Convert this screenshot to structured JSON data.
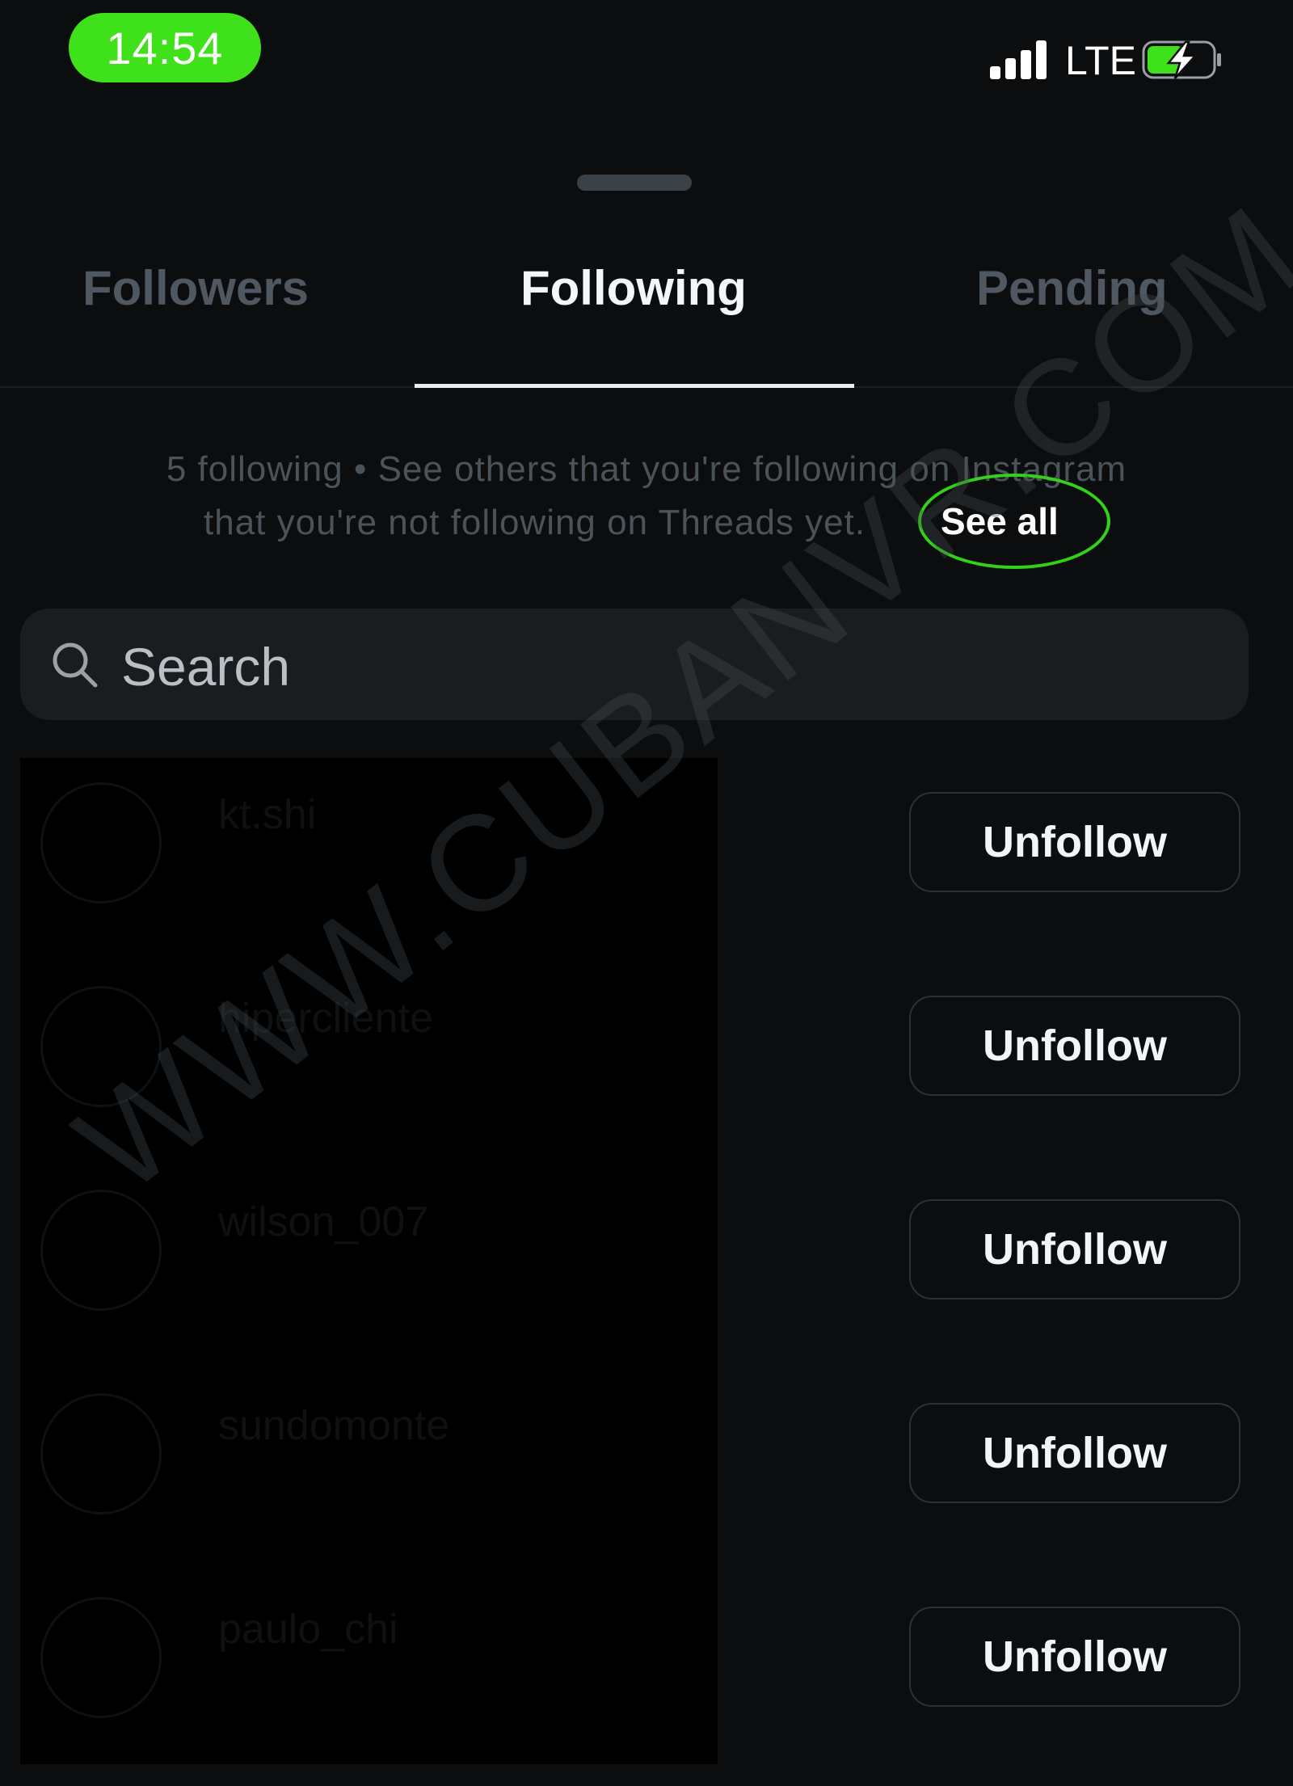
{
  "status_bar": {
    "time": "14:54",
    "network": "LTE",
    "time_pill_color": "#3fe11a",
    "battery_color": "#3fe11a"
  },
  "tabs": [
    {
      "label": "Followers",
      "selected": false
    },
    {
      "label": "Following",
      "selected": true
    },
    {
      "label": "Pending",
      "selected": false
    }
  ],
  "info": {
    "line1": "5 following • See others that you're following on Instagram",
    "line2": "that you're not following on Threads yet.",
    "see_all_label": "See all",
    "highlight_color": "#32d21a"
  },
  "search": {
    "placeholder": "Search",
    "icon": "search-icon"
  },
  "following_list": [
    {
      "username": "kt.shi",
      "button_label": "Unfollow"
    },
    {
      "username": "hipercliente",
      "button_label": "Unfollow"
    },
    {
      "username": "wilson_007",
      "button_label": "Unfollow"
    },
    {
      "username": "sundomonte",
      "button_label": "Unfollow"
    },
    {
      "username": "paulo_chi",
      "button_label": "Unfollow"
    }
  ],
  "watermark": "WWW.CUBANVR.COM"
}
